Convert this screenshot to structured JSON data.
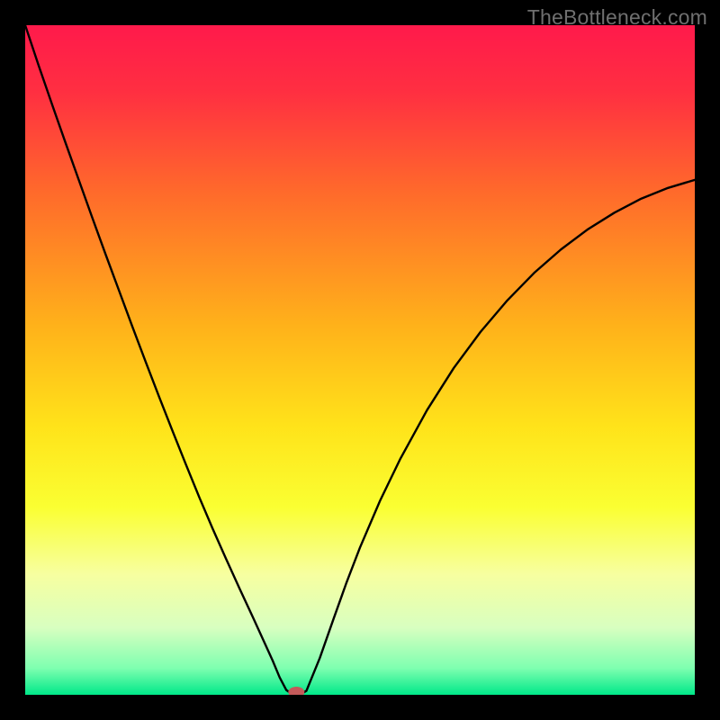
{
  "watermark": "TheBottleneck.com",
  "chart_data": {
    "type": "line",
    "title": "",
    "xlabel": "",
    "ylabel": "",
    "xlim": [
      0,
      100
    ],
    "ylim": [
      0,
      100
    ],
    "background_gradient": {
      "stops": [
        {
          "offset": 0.0,
          "color": "#ff1a4b"
        },
        {
          "offset": 0.1,
          "color": "#ff2f41"
        },
        {
          "offset": 0.25,
          "color": "#ff6a2b"
        },
        {
          "offset": 0.45,
          "color": "#ffb21a"
        },
        {
          "offset": 0.6,
          "color": "#ffe31a"
        },
        {
          "offset": 0.72,
          "color": "#faff32"
        },
        {
          "offset": 0.82,
          "color": "#f7ffa0"
        },
        {
          "offset": 0.9,
          "color": "#d8ffc0"
        },
        {
          "offset": 0.96,
          "color": "#7fffb0"
        },
        {
          "offset": 1.0,
          "color": "#00e889"
        }
      ]
    },
    "series": [
      {
        "name": "bottleneck-curve",
        "color": "#000000",
        "width": 2.4,
        "x": [
          0,
          2,
          4,
          6,
          8,
          10,
          12,
          14,
          16,
          18,
          20,
          22,
          24,
          26,
          28,
          30,
          32,
          34,
          36,
          37,
          38,
          39,
          40,
          41,
          42,
          44,
          46,
          48,
          50,
          53,
          56,
          60,
          64,
          68,
          72,
          76,
          80,
          84,
          88,
          92,
          96,
          100
        ],
        "y": [
          100,
          94,
          88.2,
          82.5,
          76.9,
          71.3,
          65.8,
          60.4,
          55.0,
          49.7,
          44.5,
          39.4,
          34.4,
          29.5,
          24.8,
          20.3,
          15.9,
          11.6,
          7.2,
          5.0,
          2.6,
          0.7,
          0.0,
          0.0,
          0.6,
          5.5,
          11.2,
          16.8,
          22.0,
          29.0,
          35.2,
          42.5,
          48.8,
          54.2,
          58.9,
          63.0,
          66.5,
          69.5,
          72.0,
          74.1,
          75.7,
          76.9
        ]
      }
    ],
    "marker": {
      "name": "optimal-point",
      "x": 40.5,
      "y": 0,
      "color": "#c45a5a",
      "rx": 9,
      "ry": 6
    }
  }
}
